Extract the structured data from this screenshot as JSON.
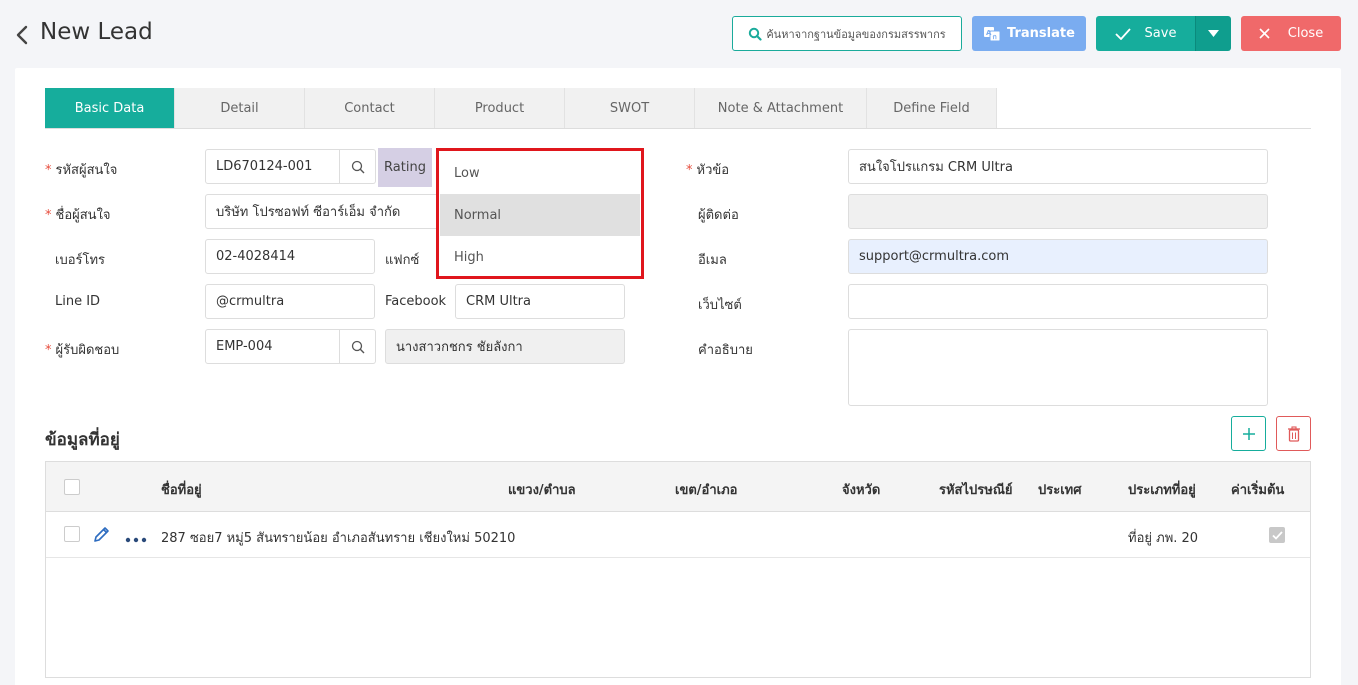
{
  "header": {
    "title": "New Lead",
    "search_db_label": "ค้นหาจากฐานข้อมูลของกรมสรรพากร",
    "translate_label": "Translate",
    "save_label": "Save",
    "close_label": "Close"
  },
  "tabs": [
    {
      "label": "Basic Data",
      "active": true
    },
    {
      "label": "Detail"
    },
    {
      "label": "Contact"
    },
    {
      "label": "Product"
    },
    {
      "label": "SWOT"
    },
    {
      "label": "Note & Attachment"
    },
    {
      "label": "Define Field"
    }
  ],
  "form": {
    "lead_code": {
      "label": "รหัสผู้สนใจ",
      "value": "LD670124-001"
    },
    "lead_name": {
      "label": "ชื่อผู้สนใจ",
      "value": "บริษัท โปรซอฟท์ ซีอาร์เอ็ม จำกัด"
    },
    "phone": {
      "label": "เบอร์โทร",
      "value": "02-4028414"
    },
    "fax": {
      "label": "แฟกซ์"
    },
    "line_id": {
      "label": "Line ID",
      "value": "@crmultra"
    },
    "facebook": {
      "label": "Facebook",
      "value": "CRM Ultra"
    },
    "owner": {
      "label": "ผู้รับผิดชอบ",
      "code": "EMP-004",
      "name": "นางสาวกชกร ชัยลังกา"
    },
    "rating": {
      "label": "Rating",
      "options": [
        "Low",
        "Normal",
        "High"
      ],
      "selected": "Normal"
    },
    "subject": {
      "label": "หัวข้อ",
      "value": "สนใจโปรแกรม CRM Ultra"
    },
    "contact": {
      "label": "ผู้ติดต่อ",
      "value": ""
    },
    "email": {
      "label": "อีเมล",
      "value": "support@crmultra.com"
    },
    "website": {
      "label": "เว็บไซต์",
      "value": ""
    },
    "description": {
      "label": "คำอธิบาย",
      "value": ""
    }
  },
  "address": {
    "title": "ข้อมูลที่อยู่",
    "columns": [
      "ชื่อที่อยู่",
      "แขวง/ตำบล",
      "เขต/อำเภอ",
      "จังหวัด",
      "รหัสไปรษณีย์",
      "ประเทศ",
      "ประเภทที่อยู่",
      "ค่าเริ่มต้น"
    ],
    "rows": [
      {
        "name": "287 ซอย7 หมู่5 สันทรายน้อย อำเภอสันทราย เชียงใหม่ 50210",
        "subdistrict": "",
        "district": "",
        "province": "",
        "postcode": "",
        "country": "",
        "type": "ที่อยู่ ภพ. 20",
        "default": true
      }
    ]
  },
  "colors": {
    "accent": "#16ad9c",
    "translate": "#7aacf0",
    "close": "#f0696a",
    "highlight": "#e0161c"
  }
}
